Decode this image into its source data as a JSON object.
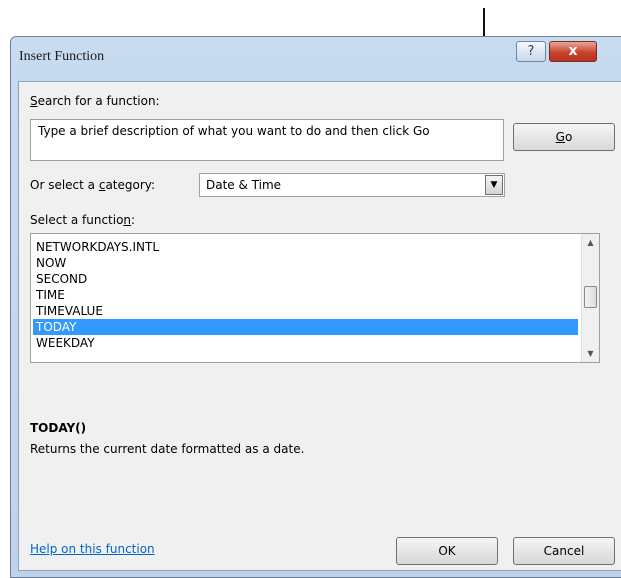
{
  "dialog": {
    "title": "Insert Function",
    "help_glyph": "?",
    "close_glyph": "x"
  },
  "search": {
    "label_u": "S",
    "label_rest": "earch for a function:",
    "value": "Type a brief description of what you want to do and then click Go",
    "go_label_u": "G",
    "go_label_rest": "o"
  },
  "category": {
    "label_before": "Or select a ",
    "label_u": "c",
    "label_after": "ategory:",
    "value": "Date & Time"
  },
  "functions": {
    "label_before": "Select a functio",
    "label_u": "n",
    "label_after": ":",
    "items": [
      "NETWORKDAYS.INTL",
      "NOW",
      "SECOND",
      "TIME",
      "TIMEVALUE",
      "TODAY",
      "WEEKDAY"
    ],
    "selected": "TODAY",
    "signature": "TODAY()",
    "description": "Returns the current date formatted as a date."
  },
  "footer": {
    "help_link": "Help on this function",
    "ok_label": "OK",
    "cancel_label": "Cancel"
  },
  "icons": {
    "dropdown_arrow": "▼",
    "scroll_up": "▲",
    "scroll_down": "▼"
  },
  "colors": {
    "selection": "#3399ff",
    "link": "#0066cc",
    "close_button": "#c8432d"
  }
}
